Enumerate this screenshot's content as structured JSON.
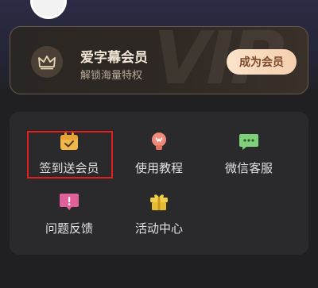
{
  "vip_card": {
    "title": "爱字幕会员",
    "subtitle": "解锁海量特权",
    "join_button": "成为会员",
    "watermark": "VIP",
    "icon": "crown-icon"
  },
  "menu": {
    "items": [
      {
        "label": "签到送会员",
        "icon": "calendar-check-icon",
        "color": "#f2b74a"
      },
      {
        "label": "使用教程",
        "icon": "lightbulb-icon",
        "color": "#f08a7a"
      },
      {
        "label": "微信客服",
        "icon": "chat-bubble-icon",
        "color": "#7fd07a"
      },
      {
        "label": "问题反馈",
        "icon": "feedback-icon",
        "color": "#e0609a"
      },
      {
        "label": "活动中心",
        "icon": "gift-icon",
        "color": "#f2cf4a"
      }
    ],
    "highlighted_item": "签到送会员",
    "highlight_color": "#e02020"
  }
}
